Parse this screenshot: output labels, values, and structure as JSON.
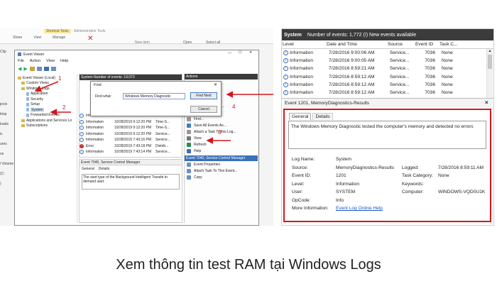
{
  "caption": "Xem thông tin test RAM tại Windows Logs",
  "left_shot": {
    "ribbon": {
      "shortcut_tools": "Shortcut Tools",
      "admin_tools": "Administrative Tools",
      "tabs": [
        "Share",
        "View",
        "Manage"
      ],
      "new_item": "New item",
      "open": "Open",
      "select_all": "Select all"
    },
    "side_labels": [
      "Clip",
      "jects",
      "ktop",
      "loads",
      "ic",
      "ures",
      "os",
      "l Volume (C:",
      ")"
    ],
    "event_viewer": {
      "title": "Event Viewer",
      "menu": [
        "File",
        "Action",
        "View",
        "Help"
      ],
      "tree": [
        "Event Viewer (Local)",
        "Custom Views",
        "Windows Logs",
        "Application",
        "Security",
        "Setup",
        "System",
        "Forwarded Events",
        "Applications and Services Lo",
        "Subscriptions"
      ],
      "list_header": "System   Number of events: 19,073",
      "list_rows": [
        {
          "level": "Information",
          "date": "10/28/2019 9:12:44 PM",
          "source": "Time-S..."
        },
        {
          "level": "Information",
          "date": "10/28/2019 9:12:20 PM",
          "source": "Time-S..."
        },
        {
          "level": "Information",
          "date": "10/28/2019 9:12:20 PM",
          "source": "Time-S..."
        },
        {
          "level": "Information",
          "date": "10/28/2019 9:12:20 PM",
          "source": "Service..."
        },
        {
          "level": "Information",
          "date": "10/28/2019 7:43:16 PM",
          "source": "Service..."
        },
        {
          "level": "Error",
          "date": "10/28/2019 7:43:18 PM",
          "source": "Distrib..."
        },
        {
          "level": "Information",
          "date": "10/28/2019 7:43:14 PM",
          "source": "Service..."
        }
      ],
      "detail_header": "Event 7040, Service Control Manager",
      "detail_tabs": [
        "General",
        "Details"
      ],
      "detail_text": "The start type of the Background Intelligent Transfe to demand start.",
      "actions_header": "Actions",
      "actions_top": [
        "Clear Log...",
        "Filter Current Log...",
        "Properties",
        "Find...",
        "Save All Events As...",
        "Attach a Task To this Log...",
        "View",
        "Refresh",
        "Help"
      ],
      "actions_sub_header": "Event 7040, Service Control Manager",
      "actions_bottom": [
        "Event Properties",
        "Attach Task To This Event...",
        "Copy"
      ]
    },
    "find_dialog": {
      "title": "Find",
      "label": "Find what:",
      "value": "Windows Memory Diagnostic",
      "find_next": "Find Next",
      "cancel": "Cancel"
    },
    "markers": [
      "1",
      "2",
      "3",
      "4"
    ]
  },
  "right_shot": {
    "header": {
      "title": "System",
      "count": "Number of events: 1,772 (!) New events available"
    },
    "columns": [
      "Level",
      "Date and Time",
      "Source",
      "Event ID",
      "Task C..."
    ],
    "rows": [
      {
        "level": "Information",
        "date": "7/28/2016 9:00:06 AM",
        "source": "Service...",
        "id": "7036",
        "task": "None"
      },
      {
        "level": "Information",
        "date": "7/28/2016 9:00:05 AM",
        "source": "Service...",
        "id": "7036",
        "task": "None"
      },
      {
        "level": "Information",
        "date": "7/28/2016 8:59:21 AM",
        "source": "Service...",
        "id": "7036",
        "task": "None"
      },
      {
        "level": "Information",
        "date": "7/28/2016 8:59:12 AM",
        "source": "Service...",
        "id": "7036",
        "task": "None"
      },
      {
        "level": "Information",
        "date": "7/28/2016 8:59:12 AM",
        "source": "Service...",
        "id": "7036",
        "task": "None"
      },
      {
        "level": "Information",
        "date": "7/28/2016 8:59:12 AM",
        "source": "Service...",
        "id": "7036",
        "task": "None"
      }
    ],
    "event_title": "Event 1201, MemoryDiagnostics-Results",
    "tabs": [
      "General",
      "Details"
    ],
    "message": "The Windows Memory Diagnostic tested the computer's memory and detected no errors",
    "props": {
      "log_name_label": "Log Name:",
      "log_name": "System",
      "source_label": "Source:",
      "source": "MemoryDiagnostics-Results",
      "logged_label": "Logged:",
      "logged": "7/28/2016 8:59:11 AM",
      "event_id_label": "Event ID:",
      "event_id": "1201",
      "task_label": "Task Category:",
      "task": "None",
      "level_label": "Level:",
      "level": "Information",
      "keywords_label": "Keywords:",
      "user_label": "User:",
      "user": "SYSTEM",
      "computer_label": "Computer:",
      "computer": "WINDOWS-VQD0U1K",
      "opcode_label": "OpCode:",
      "opcode": "Info",
      "more_label": "More Information:",
      "more_link": "Event Log Online Help"
    }
  },
  "colors": {
    "accent_red": "#d4161c",
    "header_dark": "#3b3b3b",
    "link_blue": "#1a56c6"
  }
}
